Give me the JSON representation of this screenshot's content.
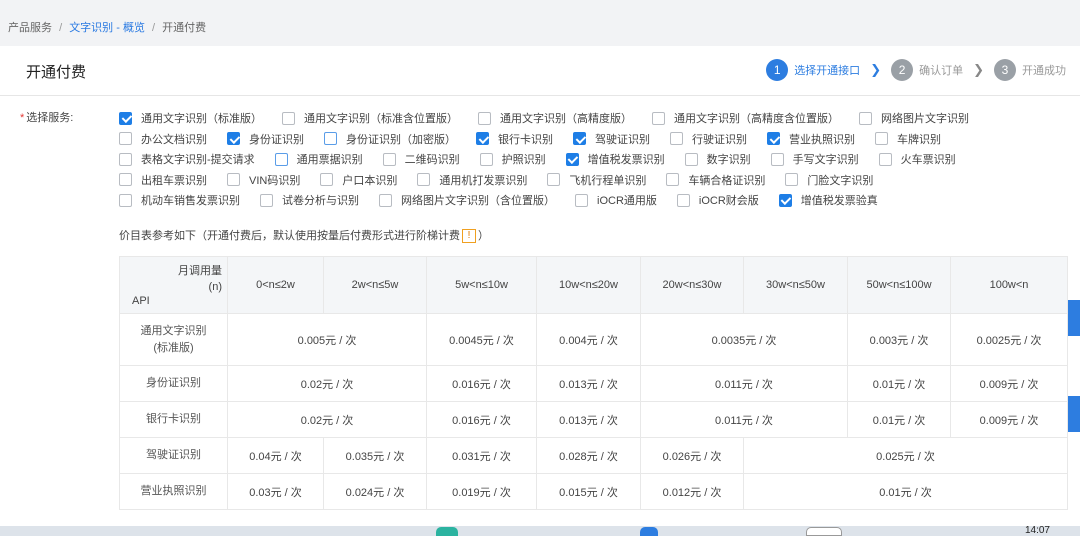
{
  "breadcrumb": [
    "产品服务",
    "文字识别 - 概览",
    "开通付费"
  ],
  "page_title": "开通付费",
  "steps": [
    {
      "num": "1",
      "label": "选择开通接口",
      "active": true
    },
    {
      "num": "2",
      "label": "确认订单",
      "active": false
    },
    {
      "num": "3",
      "label": "开通成功",
      "active": false
    }
  ],
  "service_label": "选择服务:",
  "services": [
    [
      {
        "label": "通用文字识别（标准版）",
        "checked": true
      },
      {
        "label": "通用文字识别（标准含位置版）",
        "checked": false
      },
      {
        "label": "通用文字识别（高精度版）",
        "checked": false
      },
      {
        "label": "通用文字识别（高精度含位置版）",
        "checked": false
      },
      {
        "label": "网络图片文字识别",
        "checked": false
      }
    ],
    [
      {
        "label": "办公文档识别",
        "checked": false
      },
      {
        "label": "身份证识别",
        "checked": true
      },
      {
        "label": "身份证识别（加密版）",
        "checked": false
      },
      {
        "label": "银行卡识别",
        "checked": true
      },
      {
        "label": "驾驶证识别",
        "checked": true
      },
      {
        "label": "行驶证识别",
        "checked": false
      },
      {
        "label": "营业执照识别",
        "checked": true
      },
      {
        "label": "车牌识别",
        "checked": false
      }
    ],
    [
      {
        "label": "表格文字识别-提交请求",
        "checked": false
      },
      {
        "label": "通用票据识别",
        "checked": false
      },
      {
        "label": "二维码识别",
        "checked": false
      },
      {
        "label": "护照识别",
        "checked": false
      },
      {
        "label": "增值税发票识别",
        "checked": true
      },
      {
        "label": "数字识别",
        "checked": false
      },
      {
        "label": "手写文字识别",
        "checked": false
      },
      {
        "label": "火车票识别",
        "checked": false
      }
    ],
    [
      {
        "label": "出租车票识别",
        "checked": false
      },
      {
        "label": "VIN码识别",
        "checked": false
      },
      {
        "label": "户口本识别",
        "checked": false
      },
      {
        "label": "通用机打发票识别",
        "checked": false
      },
      {
        "label": "飞机行程单识别",
        "checked": false
      },
      {
        "label": "车辆合格证识别",
        "checked": false
      },
      {
        "label": "门脸文字识别",
        "checked": false
      }
    ],
    [
      {
        "label": "机动车销售发票识别",
        "checked": false
      },
      {
        "label": "试卷分析与识别",
        "checked": false
      },
      {
        "label": "网络图片文字识别（含位置版）",
        "checked": false
      },
      {
        "label": "iOCR通用版",
        "checked": false
      },
      {
        "label": "iOCR财会版",
        "checked": false
      },
      {
        "label": "增值税发票验真",
        "checked": true
      }
    ]
  ],
  "note_prefix": "价目表参考如下（开通付费后，默认使用按量后付费形式进行阶梯计费",
  "note_warn": "!",
  "note_suffix": "）",
  "table": {
    "corner_top": "月调用量",
    "corner_n": "(n)",
    "corner_api": "API",
    "columns": [
      "0<n≤2w",
      "2w<n≤5w",
      "5w<n≤10w",
      "10w<n≤20w",
      "20w<n≤30w",
      "30w<n≤50w",
      "50w<n≤100w",
      "100w<n"
    ],
    "rows": [
      {
        "api": "通用文字识别\n(标准版)",
        "cells": [
          {
            "text": "0.005元 / 次",
            "span": 2
          },
          {
            "text": "0.0045元 / 次",
            "span": 1
          },
          {
            "text": "0.004元 / 次",
            "span": 1
          },
          {
            "text": "0.0035元 / 次",
            "span": 2
          },
          {
            "text": "0.003元 / 次",
            "span": 1
          },
          {
            "text": "0.0025元 / 次",
            "span": 1
          }
        ]
      },
      {
        "api": "身份证识别",
        "cells": [
          {
            "text": "0.02元 / 次",
            "span": 2
          },
          {
            "text": "0.016元 / 次",
            "span": 1
          },
          {
            "text": "0.013元 / 次",
            "span": 1
          },
          {
            "text": "0.011元 / 次",
            "span": 2
          },
          {
            "text": "0.01元 / 次",
            "span": 1
          },
          {
            "text": "0.009元 / 次",
            "span": 1
          }
        ]
      },
      {
        "api": "银行卡识别",
        "cells": [
          {
            "text": "0.02元 / 次",
            "span": 2
          },
          {
            "text": "0.016元 / 次",
            "span": 1
          },
          {
            "text": "0.013元 / 次",
            "span": 1
          },
          {
            "text": "0.011元 / 次",
            "span": 2
          },
          {
            "text": "0.01元 / 次",
            "span": 1
          },
          {
            "text": "0.009元 / 次",
            "span": 1
          }
        ]
      },
      {
        "api": "驾驶证识别",
        "cells": [
          {
            "text": "0.04元 / 次",
            "span": 1
          },
          {
            "text": "0.035元 / 次",
            "span": 1
          },
          {
            "text": "0.031元 / 次",
            "span": 1
          },
          {
            "text": "0.028元 / 次",
            "span": 1
          },
          {
            "text": "0.026元 / 次",
            "span": 1
          },
          {
            "text": "0.025元 / 次",
            "span": 3
          }
        ]
      },
      {
        "api": "营业执照识别",
        "cells": [
          {
            "text": "0.03元 / 次",
            "span": 1
          },
          {
            "text": "0.024元 / 次",
            "span": 1
          },
          {
            "text": "0.019元 / 次",
            "span": 1
          },
          {
            "text": "0.015元 / 次",
            "span": 1
          },
          {
            "text": "0.012元 / 次",
            "span": 1
          },
          {
            "text": "0.01元 / 次",
            "span": 3
          }
        ]
      }
    ]
  },
  "taskbar": {
    "time": "14:07"
  }
}
